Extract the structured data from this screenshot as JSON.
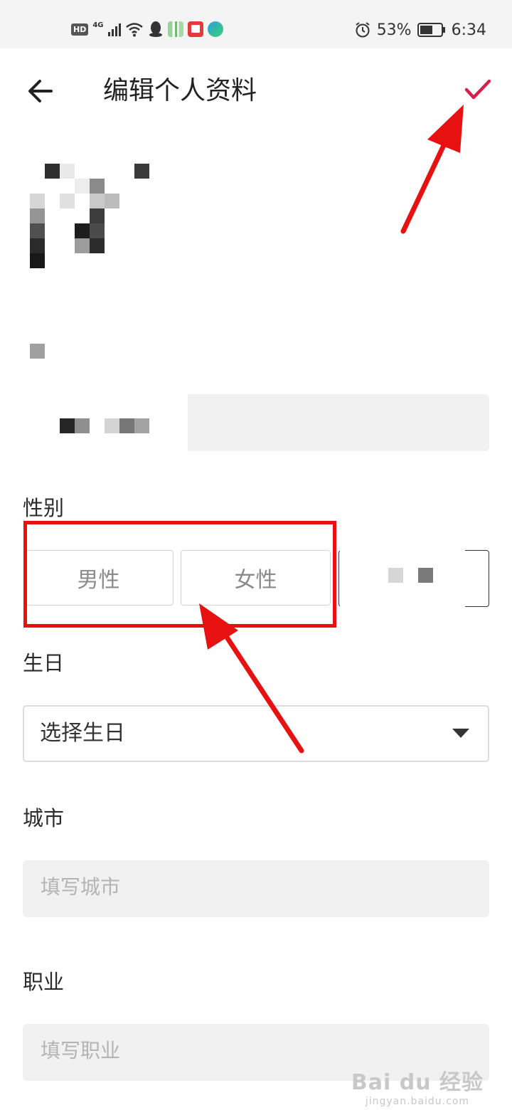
{
  "status_bar": {
    "hd": "HD",
    "network": "4G",
    "battery_pct": "53%",
    "time": "6:34",
    "icons": [
      "hd-icon",
      "signal-icon",
      "wifi-icon",
      "qq-icon",
      "bamboo-app-icon",
      "reader-app-icon",
      "video-app-icon",
      "alarm-icon",
      "battery-icon"
    ]
  },
  "header": {
    "title": "编辑个人资料",
    "back_icon": "back-arrow-icon",
    "confirm_icon": "check-icon",
    "accent_color": "#d81e4a"
  },
  "form": {
    "gender_label": "性别",
    "gender_options": [
      "男性",
      "女性"
    ],
    "birthday_label": "生日",
    "birthday_placeholder": "选择生日",
    "city_label": "城市",
    "city_placeholder": "填写城市",
    "job_label": "职业",
    "job_placeholder": "填写职业"
  },
  "annotation": {
    "color": "#e81111"
  },
  "watermark": {
    "main": "Bai du 经验",
    "sub": "jingyan.baidu.com"
  }
}
